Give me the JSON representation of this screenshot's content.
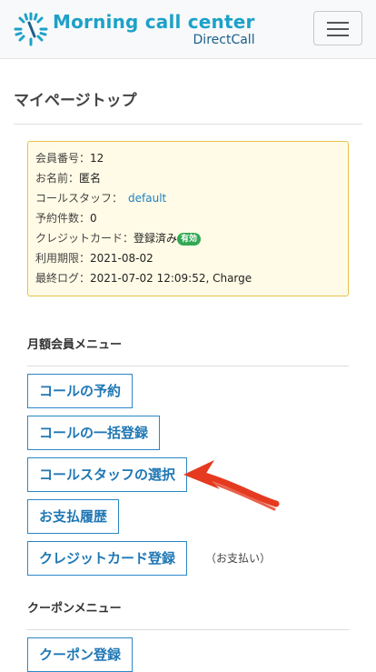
{
  "header": {
    "brand_title": "Morning call center",
    "brand_sub": "DirectCall",
    "icons": [
      "sunburst-logo-icon",
      "menu-icon"
    ]
  },
  "page": {
    "title": "マイページトップ"
  },
  "info": {
    "member_no_label": "会員番号：",
    "member_no": "12",
    "name_label": "お名前：",
    "name": "匿名",
    "staff_label": "コールスタッフ：",
    "staff": "default",
    "reservations_label": "予約件数：",
    "reservations": "0",
    "credit_label": "クレジットカード：",
    "credit": "登録済み",
    "credit_badge": "有効",
    "expiry_label": "利用期限：",
    "expiry": "2021-08-02",
    "last_login_label": "最終ログ：",
    "last_login": "2021-07-02 12:09:52, Charge"
  },
  "monthly_menu": {
    "title": "月額会員メニュー",
    "buttons": [
      "コールの予約",
      "コールの一括登録",
      "コールスタッフの選択",
      "お支払履歴",
      "クレジットカード登録"
    ],
    "card_note": "（お支払い）"
  },
  "coupon_menu": {
    "title": "クーポンメニュー",
    "buttons": [
      "クーポン登録"
    ]
  },
  "colors": {
    "brand": "#1da1c8",
    "button_border": "#2a87c7",
    "box_bg": "#fffbe6",
    "box_border": "#e8c24a",
    "badge": "#33a853",
    "arrow": "#e53a20"
  }
}
